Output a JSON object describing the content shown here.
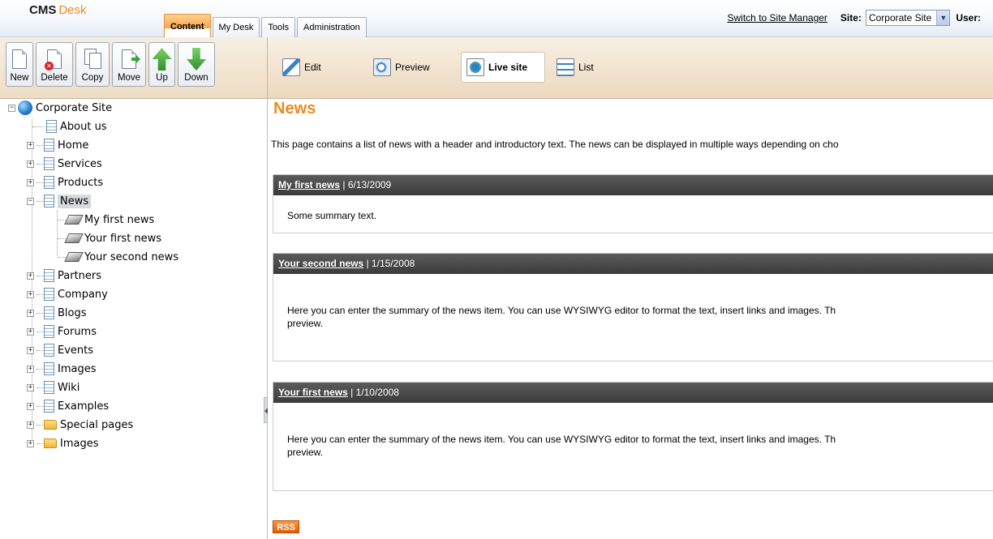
{
  "header": {
    "logo_cms": "CMS",
    "logo_desk": "Desk",
    "tabs": [
      {
        "label": "Content",
        "active": true
      },
      {
        "label": "My Desk",
        "active": false
      },
      {
        "label": "Tools",
        "active": false
      },
      {
        "label": "Administration",
        "active": false
      }
    ],
    "switch_link": "Switch to Site Manager",
    "site_label": "Site:",
    "site_value": "Corporate Site",
    "user_label": "User:"
  },
  "toolbar": {
    "new": "New",
    "delete": "Delete",
    "copy": "Copy",
    "move": "Move",
    "up": "Up",
    "down": "Down"
  },
  "actions": {
    "edit": "Edit",
    "preview": "Preview",
    "live_site": "Live site",
    "list": "List"
  },
  "tree": {
    "root": "Corporate Site",
    "items": [
      {
        "label": "About us",
        "icon": "page-icon",
        "expander": false
      },
      {
        "label": "Home",
        "icon": "page-icon",
        "expander": "+"
      },
      {
        "label": "Services",
        "icon": "page-icon",
        "expander": "+"
      },
      {
        "label": "Products",
        "icon": "page-icon",
        "expander": "+"
      },
      {
        "label": "News",
        "icon": "page-icon",
        "expander": "-",
        "selected": true
      },
      {
        "label": "My first news",
        "icon": "news-icon",
        "child": true
      },
      {
        "label": "Your first news",
        "icon": "news-icon",
        "child": true
      },
      {
        "label": "Your second news",
        "icon": "news-icon",
        "child": true
      },
      {
        "label": "Partners",
        "icon": "page-icon",
        "expander": "+"
      },
      {
        "label": "Company",
        "icon": "page-icon",
        "expander": "+"
      },
      {
        "label": "Blogs",
        "icon": "page-icon",
        "expander": "+"
      },
      {
        "label": "Forums",
        "icon": "page-icon",
        "expander": "+"
      },
      {
        "label": "Events",
        "icon": "page-icon",
        "expander": "+"
      },
      {
        "label": "Images",
        "icon": "page-icon",
        "expander": "+"
      },
      {
        "label": "Wiki",
        "icon": "page-icon",
        "expander": "+"
      },
      {
        "label": "Examples",
        "icon": "page-icon",
        "expander": "+"
      },
      {
        "label": "Special pages",
        "icon": "folder-icon",
        "expander": "+"
      },
      {
        "label": "Images",
        "icon": "folder-icon",
        "expander": "+"
      }
    ]
  },
  "content": {
    "title": "News",
    "intro": "This page contains a list of news with a header and introductory text. The news can be displayed in multiple ways depending on cho",
    "news": [
      {
        "title": "My first news",
        "date": "| 6/13/2009",
        "summary": "Some summary text.",
        "summary2": ""
      },
      {
        "title": "Your second news",
        "date": "| 1/15/2008",
        "summary": "Here you can enter the summary of the news item. You can use WYSIWYG editor to format the text, insert links and images. Th",
        "summary2": "preview."
      },
      {
        "title": "Your first news",
        "date": "| 1/10/2008",
        "summary": "Here you can enter the summary of the news item. You can use WYSIWYG editor to format the text, insert links and images. Th",
        "summary2": "preview."
      }
    ],
    "rss": "RSS"
  },
  "colors": {
    "accent_orange": "#f08a1d",
    "news_header_bg": "#444444",
    "toolbar_bg": "#f0e2cf"
  }
}
